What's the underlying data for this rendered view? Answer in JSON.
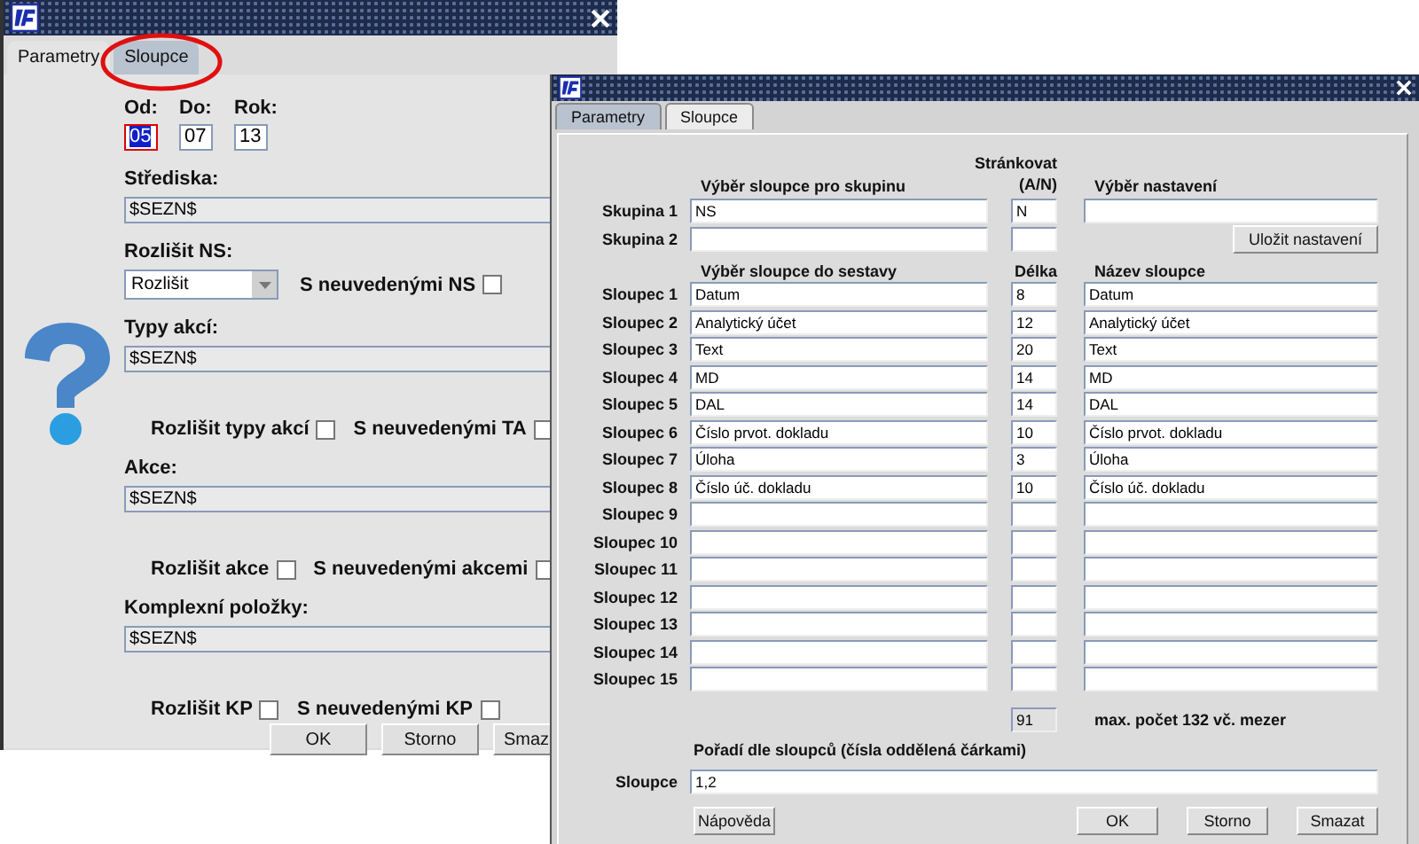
{
  "back_window": {
    "tabs": [
      {
        "label": "Parametry",
        "selected": true
      },
      {
        "label": "Sloupce",
        "selected": false
      }
    ],
    "period": [
      {
        "label": "Od:",
        "value": "05",
        "selected": true
      },
      {
        "label": "Do:",
        "value": "07",
        "selected": false
      },
      {
        "label": "Rok:",
        "value": "13",
        "selected": false
      }
    ],
    "rows": [
      {
        "kind": "heading",
        "text": "Střediska:"
      },
      {
        "kind": "field",
        "value": "$SEZN$"
      },
      {
        "kind": "heading",
        "text": "Rozlišit NS:"
      },
      {
        "kind": "dropdown",
        "value": "Rozlišit",
        "checks": [
          {
            "label": "S neuvedenými NS",
            "checked": false
          }
        ]
      },
      {
        "kind": "heading",
        "text": "Typy akcí:"
      },
      {
        "kind": "field",
        "value": "$SEZN$"
      },
      {
        "kind": "checks",
        "checks": [
          {
            "label": "Rozlišit typy akcí",
            "checked": false
          },
          {
            "label": "S neuvedenými TA",
            "checked": false
          }
        ]
      },
      {
        "kind": "heading",
        "text": "Akce:"
      },
      {
        "kind": "field",
        "value": "$SEZN$"
      },
      {
        "kind": "checks",
        "checks": [
          {
            "label": "Rozlišit akce",
            "checked": false
          },
          {
            "label": "S neuvedenými akcemi",
            "checked": false
          }
        ]
      },
      {
        "kind": "heading",
        "text": "Komplexní položky:"
      },
      {
        "kind": "field",
        "value": "$SEZN$"
      },
      {
        "kind": "checks",
        "checks": [
          {
            "label": "Rozlišit KP",
            "checked": false
          },
          {
            "label": "S neuvedenými KP",
            "checked": false
          }
        ]
      }
    ],
    "buttons": [
      "OK",
      "Storno",
      "Smaz"
    ]
  },
  "front_window": {
    "tabs": [
      {
        "label": "Parametry",
        "selected": false
      },
      {
        "label": "Sloupce",
        "selected": true
      }
    ],
    "group_headers": {
      "column": "Výběr sloupce pro skupinu",
      "paging": "Stránkovat (A/N)",
      "settings": "Výběr nastavení"
    },
    "groups": [
      {
        "label": "Skupina 1",
        "column": "NS",
        "paging": "N"
      },
      {
        "label": "Skupina 2"
      }
    ],
    "save_button": "Uložit nastavení",
    "column_headers": {
      "column": "Výběr sloupce do sestavy",
      "length": "Délka",
      "name": "Název sloupce"
    },
    "columns": [
      {
        "label": "Sloupec 1",
        "column": "Datum",
        "length": "8",
        "name": "Datum"
      },
      {
        "label": "Sloupec 2",
        "column": "Analytický účet",
        "length": "12",
        "name": "Analytický účet"
      },
      {
        "label": "Sloupec 3",
        "column": "Text",
        "length": "20",
        "name": "Text"
      },
      {
        "label": "Sloupec 4",
        "column": "MD",
        "length": "14",
        "name": "MD"
      },
      {
        "label": "Sloupec 5",
        "column": "DAL",
        "length": "14",
        "name": "DAL"
      },
      {
        "label": "Sloupec 6",
        "column": "Číslo prvot. dokladu",
        "length": "10",
        "name": "Číslo prvot. dokladu"
      },
      {
        "label": "Sloupec 7",
        "column": "Úloha",
        "length": "3",
        "name": "Úloha"
      },
      {
        "label": "Sloupec 8",
        "column": "Číslo úč. dokladu",
        "length": "10",
        "name": "Číslo úč. dokladu"
      },
      {
        "label": "Sloupec 9"
      },
      {
        "label": "Sloupec 10"
      },
      {
        "label": "Sloupec 11"
      },
      {
        "label": "Sloupec 12"
      },
      {
        "label": "Sloupec 13"
      },
      {
        "label": "Sloupec 14"
      },
      {
        "label": "Sloupec 15"
      }
    ],
    "total": "91",
    "total_note": "max. počet 132 vč. mezer",
    "order_heading": "Pořadí dle sloupců (čísla oddělená čárkami)",
    "order": {
      "label": "Sloupce",
      "value": "1,2"
    },
    "help_button": "Nápověda",
    "buttons": [
      "OK",
      "Storno",
      "Smazat"
    ]
  }
}
